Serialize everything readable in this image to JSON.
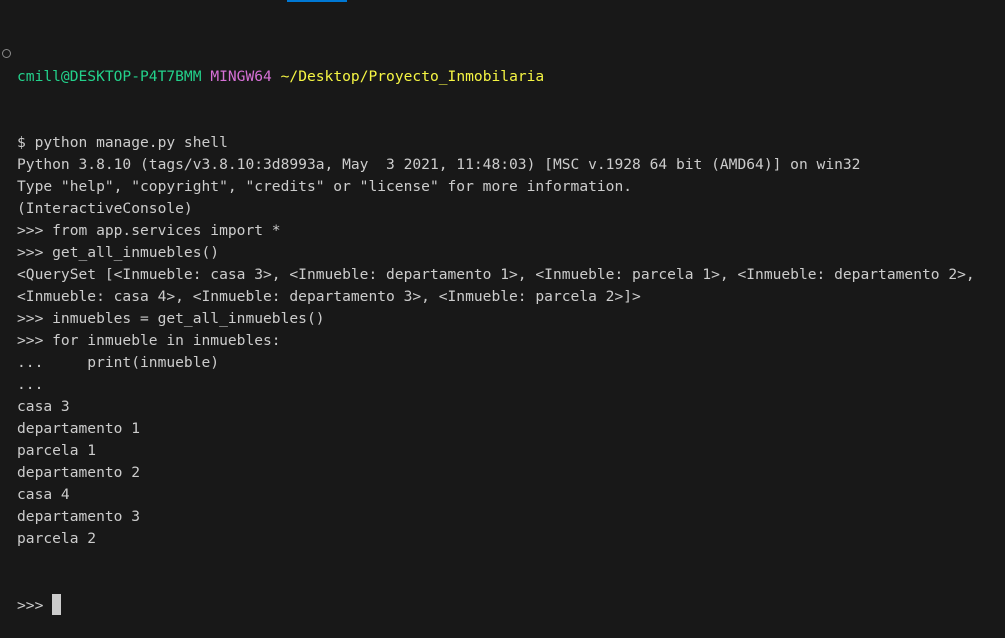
{
  "prompt": {
    "user": "cmill@DESKTOP-P4T7BMM",
    "system": "MINGW64",
    "path": "~/Desktop/Proyecto_Inmobilaria"
  },
  "lines": [
    "$ python manage.py shell",
    "Python 3.8.10 (tags/v3.8.10:3d8993a, May  3 2021, 11:48:03) [MSC v.1928 64 bit (AMD64)] on win32",
    "Type \"help\", \"copyright\", \"credits\" or \"license\" for more information.",
    "(InteractiveConsole)",
    ">>> from app.services import *",
    ">>> get_all_inmuebles()",
    "<QuerySet [<Inmueble: casa 3>, <Inmueble: departamento 1>, <Inmueble: parcela 1>, <Inmueble: departamento 2>,",
    "<Inmueble: casa 4>, <Inmueble: departamento 3>, <Inmueble: parcela 2>]>",
    ">>> inmuebles = get_all_inmuebles()",
    ">>> for inmueble in inmuebles:",
    "...     print(inmueble)",
    "...",
    "casa 3",
    "departamento 1",
    "parcela 1",
    "departamento 2",
    "casa 4",
    "departamento 3",
    "parcela 2"
  ],
  "current_prompt": ">>> "
}
